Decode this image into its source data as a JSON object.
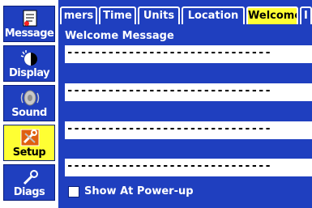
{
  "sidebar": {
    "items": [
      {
        "label": "Message",
        "icon": "message-icon"
      },
      {
        "label": "Display",
        "icon": "display-icon"
      },
      {
        "label": "Sound",
        "icon": "speaker-icon"
      },
      {
        "label": "Setup",
        "icon": "setup-icon",
        "selected": true
      },
      {
        "label": "Diags",
        "icon": "wrench-icon"
      }
    ]
  },
  "tabs": [
    {
      "label": "mers"
    },
    {
      "label": "Time"
    },
    {
      "label": "Units"
    },
    {
      "label": "Location"
    },
    {
      "label": "Welcome",
      "active": true
    },
    {
      "label": "I"
    }
  ],
  "main": {
    "section_title": "Welcome Message",
    "lines": [
      "------------------------------",
      "------------------------------",
      "------------------------------",
      "------------------------------"
    ],
    "checkbox_label": "Show At Power-up",
    "checkbox_checked": false
  },
  "colors": {
    "background_blue": "#1f3fbf",
    "highlight_yellow": "#ffff33",
    "text_white": "#ffffff"
  }
}
